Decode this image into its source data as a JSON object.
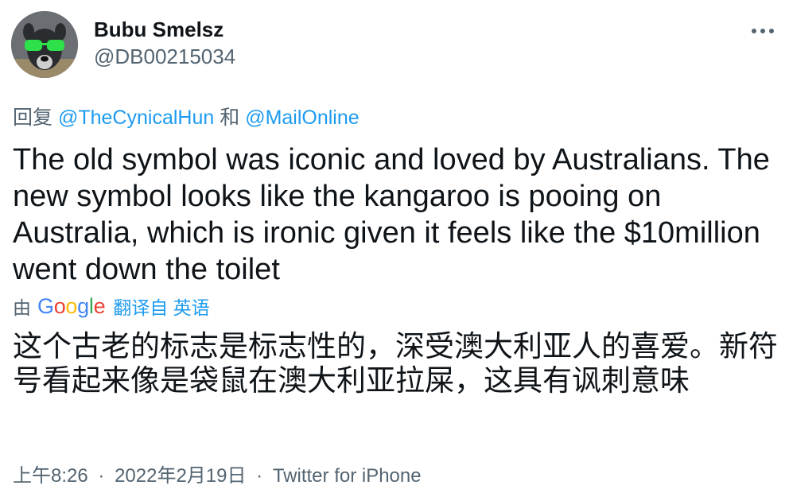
{
  "user": {
    "display_name": "Bubu Smelsz",
    "handle": "@DB00215034"
  },
  "reply": {
    "prefix": "回复",
    "mention_1": "@TheCynicalHun",
    "conjunction": "和",
    "mention_2": "@MailOnline"
  },
  "tweet": {
    "text": "The old symbol was iconic and loved by Australians. The new symbol looks like the kangaroo is pooing on Australia, which is ironic given it feels like the $10million went down the toilet"
  },
  "translation": {
    "prefix": "由",
    "provider": "Google",
    "link_label": "翻译自 英语",
    "text": "这个古老的标志是标志性的，深受澳大利亚人的喜爱。新符号看起来像是袋鼠在澳大利亚拉屎，这具有讽刺意味"
  },
  "meta": {
    "time": "上午8:26",
    "separator": "·",
    "date": "2022年2月19日",
    "source": "Twitter for iPhone"
  },
  "colors": {
    "link": "#1d9bf0",
    "secondary_text": "#536471",
    "primary_text": "#0f1419",
    "google_blue": "#4285F4",
    "google_red": "#EA4335",
    "google_yellow": "#FBBC05",
    "google_green": "#34A853"
  },
  "icons": {
    "avatar": "dog-with-green-sunglasses-avatar",
    "more": "more-horizontal-icon"
  }
}
